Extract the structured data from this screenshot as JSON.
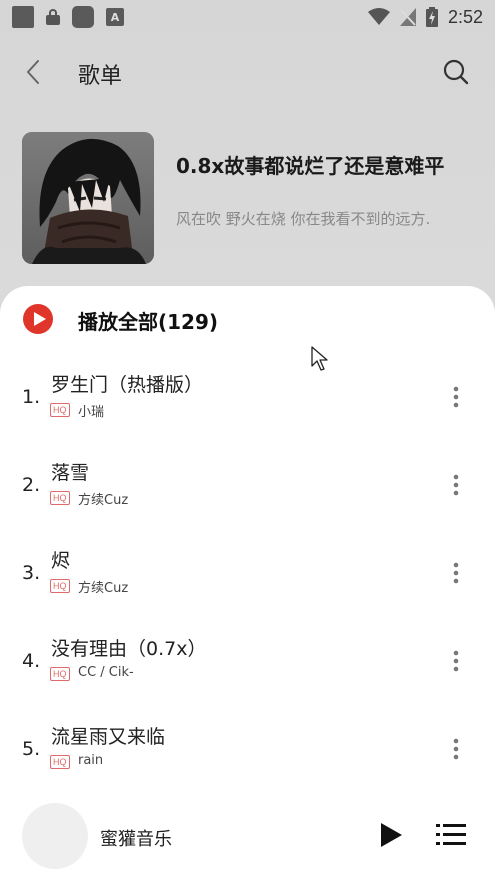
{
  "status_bar": {
    "time": "2:52",
    "notification_a": "A"
  },
  "header": {
    "title": "歌单"
  },
  "playlist": {
    "name": "0.8x故事都说烂了还是意难平",
    "description": "风在吹 野火在烧 你在我看不到的远方."
  },
  "play_all": {
    "label": "播放全部(129)"
  },
  "songs": [
    {
      "num": "1.",
      "title": "罗生门（热播版）",
      "quality": "HQ",
      "artist": "小瑞"
    },
    {
      "num": "2.",
      "title": "落雪",
      "quality": "HQ",
      "artist": "方续Cuz"
    },
    {
      "num": "3.",
      "title": "烬",
      "quality": "HQ",
      "artist": "方续Cuz"
    },
    {
      "num": "4.",
      "title": "没有理由（0.7x）",
      "quality": "HQ",
      "artist": "CC / Cik-"
    },
    {
      "num": "5.",
      "title": "流星雨又来临",
      "quality": "HQ",
      "artist": "rain"
    }
  ],
  "player": {
    "title": "蜜獾音乐"
  },
  "colors": {
    "accent": "#e0352b",
    "hq": "#e06a6a",
    "background": "#d9d9d9"
  }
}
